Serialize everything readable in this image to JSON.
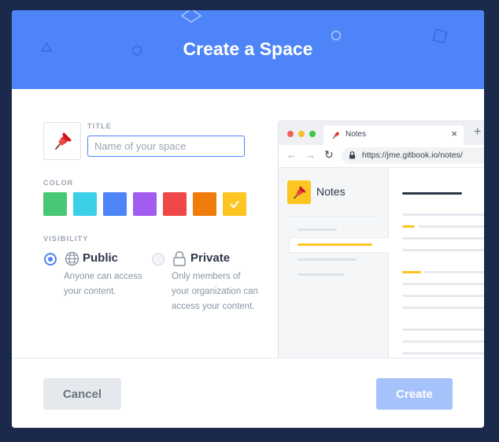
{
  "dialog": {
    "title": "Create a Space"
  },
  "form": {
    "title_label": "TITLE",
    "title_placeholder": "Name of your space",
    "title_value": "",
    "color_label": "COLOR",
    "colors": [
      "#48c774",
      "#3cd0e8",
      "#4d84f7",
      "#a35cf0",
      "#f04848",
      "#f07c0c",
      "#fcc521"
    ],
    "selected_color_index": 6,
    "visibility_label": "VISIBILITY",
    "visibility_options": [
      {
        "label": "Public",
        "description": "Anyone can access your content.",
        "selected": true,
        "icon": "globe-icon"
      },
      {
        "label": "Private",
        "description": "Only members of your organization can access your content.",
        "selected": false,
        "icon": "lock-icon"
      }
    ]
  },
  "preview": {
    "tab_title": "Notes",
    "url": "https://jme.gitbook.io/notes/",
    "space_name": "Notes",
    "accent_color": "#fcc521"
  },
  "footer": {
    "cancel_label": "Cancel",
    "create_label": "Create"
  }
}
